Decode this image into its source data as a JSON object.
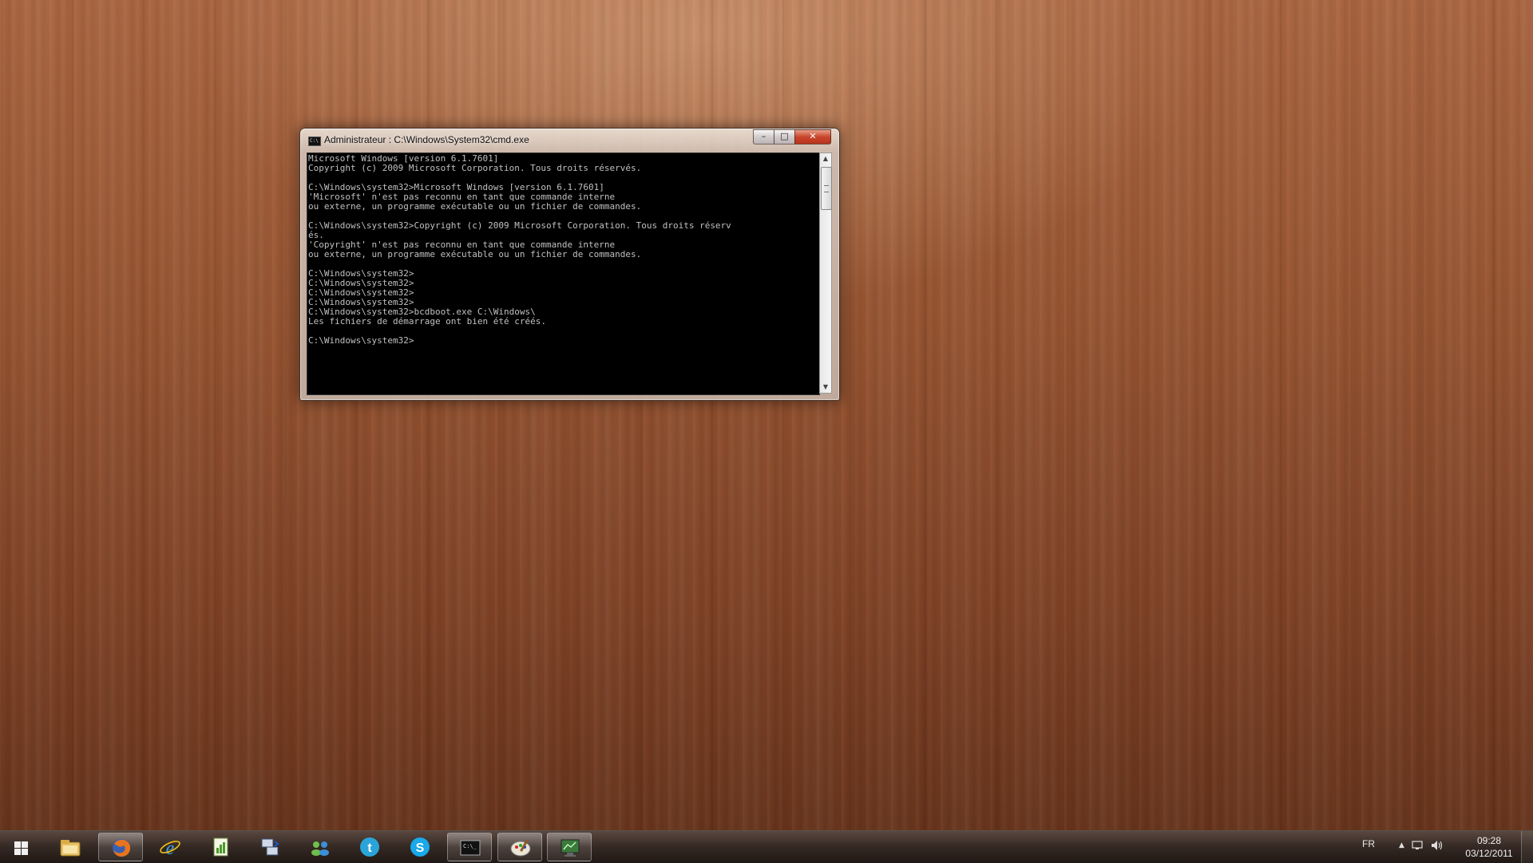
{
  "cmd_window": {
    "title": "Administrateur : C:\\Windows\\System32\\cmd.exe",
    "minimize_glyph": "–",
    "maximize_glyph": "□",
    "close_glyph": "✕",
    "console_lines": [
      "Microsoft Windows [version 6.1.7601]",
      "Copyright (c) 2009 Microsoft Corporation. Tous droits réservés.",
      "",
      "C:\\Windows\\system32>Microsoft Windows [version 6.1.7601]",
      "'Microsoft' n'est pas reconnu en tant que commande interne",
      "ou externe, un programme exécutable ou un fichier de commandes.",
      "",
      "C:\\Windows\\system32>Copyright (c) 2009 Microsoft Corporation. Tous droits réserv",
      "és.",
      "'Copyright' n'est pas reconnu en tant que commande interne",
      "ou externe, un programme exécutable ou un fichier de commandes.",
      "",
      "C:\\Windows\\system32>",
      "C:\\Windows\\system32>",
      "C:\\Windows\\system32>",
      "C:\\Windows\\system32>",
      "C:\\Windows\\system32>bcdboot.exe C:\\Windows\\",
      "Les fichiers de démarrage ont bien été créés.",
      "",
      "C:\\Windows\\system32>"
    ]
  },
  "taskbar": {
    "apps": [
      {
        "name": "file-explorer-icon",
        "active": false
      },
      {
        "name": "firefox-icon",
        "active": true
      },
      {
        "name": "internet-explorer-icon",
        "active": false
      },
      {
        "name": "notepad-chart-icon",
        "active": false
      },
      {
        "name": "network-transfer-icon",
        "active": false
      },
      {
        "name": "contacts-icon",
        "active": false
      },
      {
        "name": "twitter-icon",
        "active": false
      },
      {
        "name": "skype-icon",
        "active": false
      },
      {
        "name": "command-prompt-icon",
        "active": true
      },
      {
        "name": "paint-icon",
        "active": true
      },
      {
        "name": "monitor-icon",
        "active": true
      }
    ],
    "tray": {
      "language": "FR",
      "time": "09:28",
      "date": "03/12/2011"
    }
  },
  "colors": {
    "console_bg": "#000000",
    "console_fg": "#c0c0c0",
    "close_button": "#c9462c"
  }
}
